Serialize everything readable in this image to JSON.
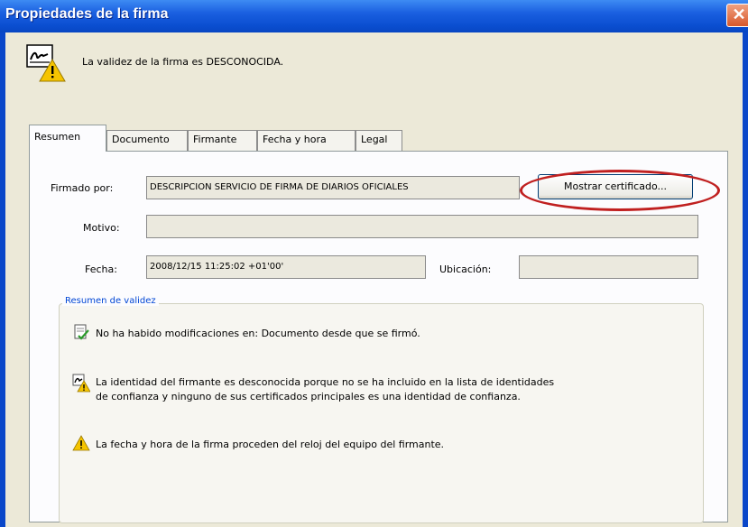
{
  "window": {
    "title": "Propiedades de la firma",
    "close_glyph": "✕"
  },
  "header": {
    "icon": "signature-warning-icon",
    "status_text": "La validez de la firma es DESCONOCIDA."
  },
  "tabs": [
    {
      "label": "Resumen",
      "active": true
    },
    {
      "label": "Documento",
      "active": false
    },
    {
      "label": "Firmante",
      "active": false
    },
    {
      "label": "Fecha y hora",
      "active": false
    },
    {
      "label": "Legal",
      "active": false
    }
  ],
  "summary": {
    "firmado_por_label": "Firmado por:",
    "firmado_por_value": "DESCRIPCION SERVICIO DE FIRMA DE DIARIOS OFICIALES",
    "mostrar_certificado": "Mostrar certificado...",
    "motivo_label": "Motivo:",
    "motivo_value": "",
    "fecha_label": "Fecha:",
    "fecha_value": "2008/12/15 11:25:02 +01'00'",
    "ubicacion_label": "Ubicación:",
    "ubicacion_value": ""
  },
  "validity": {
    "group_title": "Resumen de validez",
    "messages": [
      {
        "icon": "document-check-icon",
        "text": "No ha habido modificaciones en: Documento desde que se firmó."
      },
      {
        "icon": "signer-warning-icon",
        "line1": "La identidad del firmante es desconocida porque no se ha incluido en la lista de identidades",
        "line2": "de confianza y ninguno de sus certificados principales es una identidad de confianza."
      },
      {
        "icon": "warning-icon",
        "text": "La fecha y hora de la firma proceden del reloj del equipo del firmante."
      }
    ]
  },
  "colors": {
    "titlebar": "#0a4ed0",
    "dialog_bg": "#ece9d8",
    "highlight_circle": "#c02020",
    "group_title": "#0046d5"
  }
}
